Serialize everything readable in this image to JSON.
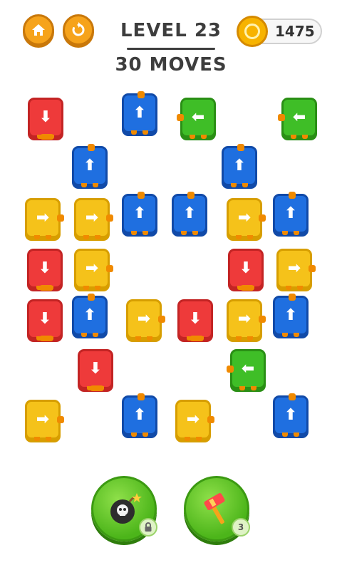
{
  "header": {
    "level": "LEVEL 23",
    "moves": "30 MOVES",
    "coins": "1475"
  },
  "icons": {
    "home": "home-icon",
    "restart": "restart-icon",
    "coin": "coin-icon",
    "bomb": "bomb-icon",
    "hammer": "hammer-icon",
    "lock": "lock-icon"
  },
  "colors": {
    "red": "#ee3a3a",
    "blue": "#1f6fe0",
    "green": "#3fbe27",
    "yellow": "#f5c21a",
    "accent": "#f6a31b"
  },
  "board": {
    "tiles": [
      {
        "color": "red",
        "dir": "down"
      },
      {
        "color": "blue",
        "dir": "up"
      },
      {
        "color": "green",
        "dir": "left"
      },
      {
        "color": "green",
        "dir": "left"
      },
      {
        "color": "blue",
        "dir": "up"
      },
      {
        "color": "blue",
        "dir": "up"
      },
      {
        "color": "yellow",
        "dir": "right"
      },
      {
        "color": "yellow",
        "dir": "right"
      },
      {
        "color": "blue",
        "dir": "up"
      },
      {
        "color": "blue",
        "dir": "up"
      },
      {
        "color": "yellow",
        "dir": "right"
      },
      {
        "color": "blue",
        "dir": "up"
      },
      {
        "color": "red",
        "dir": "down"
      },
      {
        "color": "yellow",
        "dir": "right"
      },
      {
        "color": "red",
        "dir": "down"
      },
      {
        "color": "yellow",
        "dir": "right"
      },
      {
        "color": "red",
        "dir": "down"
      },
      {
        "color": "blue",
        "dir": "up"
      },
      {
        "color": "yellow",
        "dir": "right"
      },
      {
        "color": "red",
        "dir": "down"
      },
      {
        "color": "yellow",
        "dir": "right"
      },
      {
        "color": "blue",
        "dir": "up"
      },
      {
        "color": "red",
        "dir": "down"
      },
      {
        "color": "green",
        "dir": "left"
      },
      {
        "color": "yellow",
        "dir": "right"
      },
      {
        "color": "blue",
        "dir": "up"
      },
      {
        "color": "yellow",
        "dir": "right"
      },
      {
        "color": "blue",
        "dir": "up"
      }
    ]
  },
  "powerups": {
    "bomb_locked": true,
    "hammer_count": "3"
  }
}
